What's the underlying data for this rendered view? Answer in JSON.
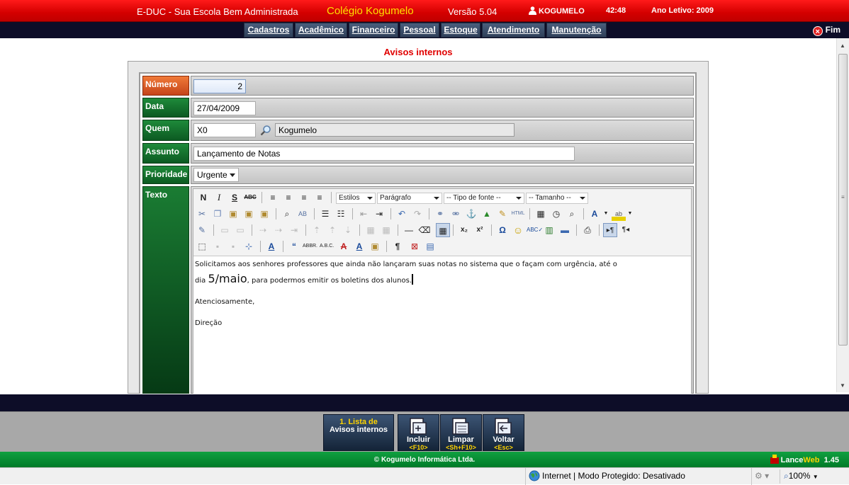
{
  "header": {
    "app_name": "E-DUC - Sua Escola Bem Administrada",
    "school_name": "Colégio Kogumelo",
    "version": "Versão 5.04",
    "user": "KOGUMELO",
    "clock": "42:48",
    "school_year": "Ano Letivo: 2009"
  },
  "nav": {
    "items": [
      "Cadastros",
      "Acadêmico",
      "Financeiro",
      "Pessoal",
      "Estoque",
      "Atendimento",
      "Manutenção"
    ],
    "exit_label": "Fim"
  },
  "page": {
    "title": "Avisos internos"
  },
  "form": {
    "numero": {
      "label": "Número",
      "value": "2"
    },
    "data": {
      "label": "Data",
      "value": "27/04/2009"
    },
    "quem": {
      "label": "Quem",
      "code": "X0",
      "name": "Kogumelo"
    },
    "assunto": {
      "label": "Assunto",
      "value": "Lançamento de Notas"
    },
    "prioridade": {
      "label": "Prioridade",
      "value": "Urgente"
    },
    "texto": {
      "label": "Texto"
    }
  },
  "editor": {
    "styles_select": "Estilos",
    "format_select": "Parágrafo",
    "font_select": "-- Tipo de fonte --",
    "size_select": "-- Tamanho --",
    "content": {
      "line1": "Solicitamos aos senhores professores que ainda não lançaram suas notas no sistema que o façam com urgência, até o",
      "line2_prefix": "dia",
      "line2_big": "5/maio",
      "line2_suffix": ", para podermos emitir os boletins dos alunos.",
      "line3": "Atenciosamente,",
      "line4": "Direção"
    }
  },
  "actions": {
    "list_line1": "1. Lista de",
    "list_line2": "Avisos internos",
    "buttons": [
      {
        "label": "Incluir",
        "shortcut": "<F10>"
      },
      {
        "label": "Limpar",
        "shortcut": "<Sh+F10>"
      },
      {
        "label": "Voltar",
        "shortcut": "<Esc>"
      }
    ]
  },
  "footer": {
    "copyright": "© Kogumelo Informática Ltda.",
    "brand_a": "Lance",
    "brand_b": "Web",
    "brand_version": "1.45"
  },
  "statusbar": {
    "zone": "Internet | Modo Protegido: Desativado",
    "zoom": "100%"
  },
  "colors": {
    "header_red": "#d40000",
    "school_yellow": "#ffe000",
    "label_green": "#0c5a22",
    "label_orange": "#c5441a",
    "page_title_red": "#e00000",
    "nav_dark": "#0d0d28"
  }
}
